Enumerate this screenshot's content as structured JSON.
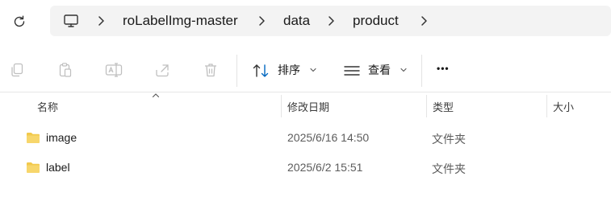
{
  "address_bar": {
    "breadcrumbs": [
      "roLabelImg-master",
      "data",
      "product"
    ]
  },
  "toolbar": {
    "sort_label": "排序",
    "view_label": "查看",
    "more_label": "•••"
  },
  "columns": {
    "name": "名称",
    "modified": "修改日期",
    "type": "类型",
    "size": "大小"
  },
  "files": [
    {
      "name": "image",
      "modified": "2025/6/16 14:50",
      "type": "文件夹"
    },
    {
      "name": "label",
      "modified": "2025/6/2 15:51",
      "type": "文件夹"
    }
  ],
  "colors": {
    "folder": "#f2c94c",
    "accent": "#0067c0",
    "disabled_icon": "#bfbfbf"
  }
}
